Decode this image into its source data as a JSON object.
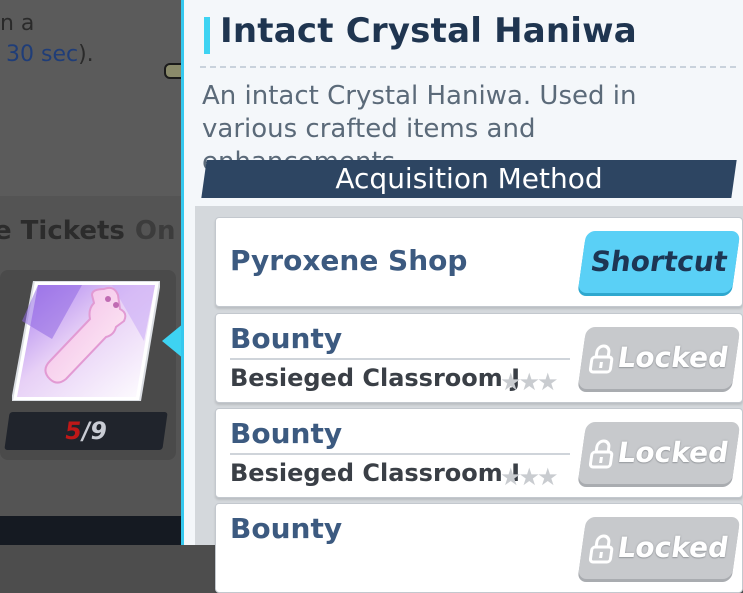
{
  "background": {
    "partial_text_line1": "n a",
    "partial_text_line2_link": "30 sec",
    "partial_text_line2_suffix": ").",
    "tickets_label": "e Tickets",
    "tickets_state": "On",
    "item_count_current": "5",
    "item_count_separator": "/",
    "item_count_max": "9"
  },
  "panel": {
    "title": "Intact Crystal Haniwa",
    "description": "An intact Crystal Haniwa. Used in various crafted items and enhancements.",
    "section_header": "Acquisition Method",
    "methods": [
      {
        "name": "Pyroxene Shop",
        "button_label": "Shortcut"
      },
      {
        "name": "Bounty",
        "stage": "Besieged Classroom J",
        "stars": "★★★",
        "button_label": "Locked"
      },
      {
        "name": "Bounty",
        "stage": "Besieged Classroom I",
        "stars": "★★★",
        "button_label": "Locked"
      },
      {
        "name": "Bounty",
        "button_label": "Locked"
      }
    ]
  },
  "colors": {
    "accent": "#3ed3f2",
    "title": "#1f3550",
    "header_bg": "#2d4562",
    "shortcut_button": "#5ad0f6",
    "locked_button": "#c7c9cc"
  }
}
